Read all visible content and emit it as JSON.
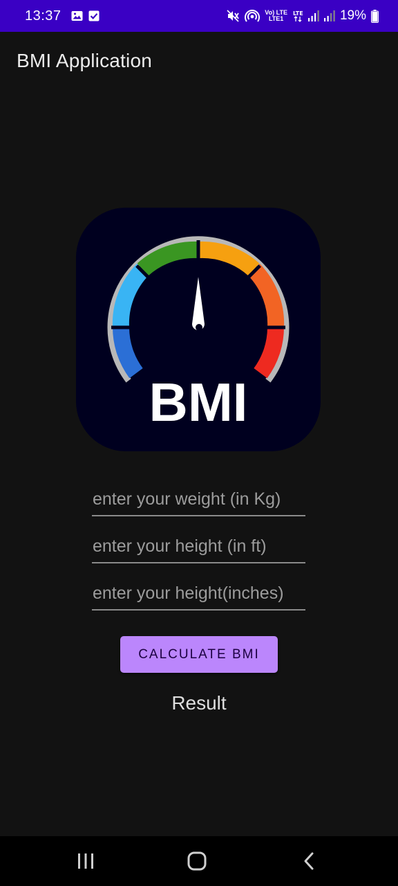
{
  "status_bar": {
    "time": "13:37",
    "battery_text": "19%",
    "network_label_top": "Vo) LTE",
    "network_label_bottom": "LTE1",
    "icons": [
      "image-icon",
      "check-square-icon",
      "mute-icon",
      "hotspot-icon",
      "volte-icon",
      "lte-icon",
      "signal-icon",
      "signal-icon",
      "battery-icon"
    ]
  },
  "app_bar": {
    "title": "BMI Application"
  },
  "logo": {
    "text": "BMI",
    "colors": {
      "background": "#00001f",
      "gauge_blue_dark": "#2b6fd6",
      "gauge_blue_light": "#39b4f4",
      "gauge_green": "#3a9622",
      "gauge_yellow": "#f6a010",
      "gauge_orange": "#f26424",
      "gauge_red": "#ee2a20",
      "rim": "#b8b8b8"
    }
  },
  "form": {
    "weight_placeholder": "enter your weight (in Kg)",
    "height_ft_placeholder": "enter your height (in ft)",
    "height_in_placeholder": "enter your height(inches)",
    "calculate_label": "CALCULATE BMI"
  },
  "result": {
    "text": "Result"
  },
  "colors": {
    "status_bar": "#3a00c4",
    "background": "#121212",
    "accent": "#bb86fc"
  },
  "nav_bar": {
    "icons": [
      "recent-apps-icon",
      "home-icon",
      "back-icon"
    ]
  }
}
